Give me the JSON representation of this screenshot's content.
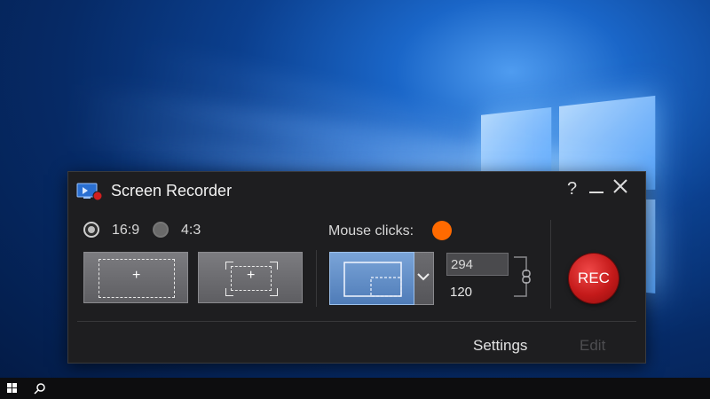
{
  "window": {
    "title": "Screen Recorder",
    "help_label": "?",
    "minimize_label": "—",
    "close_label": "✕"
  },
  "aspect": {
    "options": [
      {
        "label": "16:9",
        "selected": true
      },
      {
        "label": "4:3",
        "selected": false
      }
    ]
  },
  "capture_buttons": {
    "fullscreen_plus": "+",
    "custom_plus": "+"
  },
  "mouse_clicks": {
    "label": "Mouse clicks:",
    "color": "#ff6a00"
  },
  "dimensions": {
    "width": "294",
    "height": "120"
  },
  "rec": {
    "label": "REC"
  },
  "footer": {
    "settings_label": "Settings",
    "edit_label": "Edit"
  },
  "colors": {
    "rec_red": "#c41a1a",
    "mode_blue": "#5a87c4",
    "panel_bg": "#1e1e20"
  }
}
